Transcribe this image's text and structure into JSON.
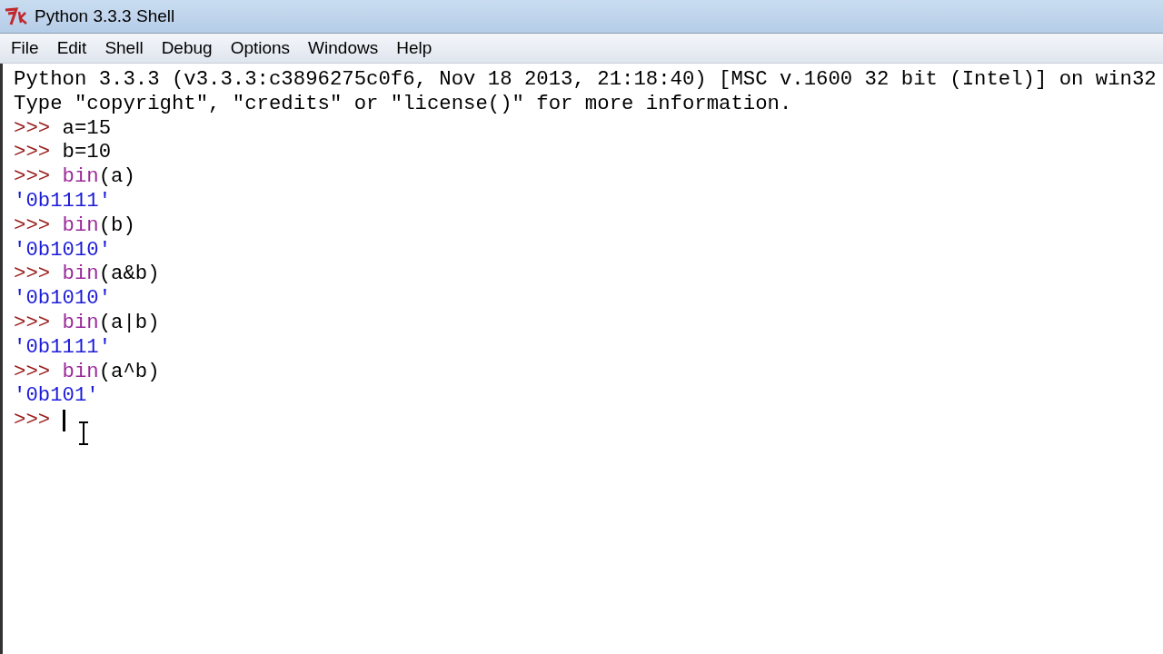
{
  "window": {
    "title": "Python 3.3.3 Shell"
  },
  "menu": [
    "File",
    "Edit",
    "Shell",
    "Debug",
    "Options",
    "Windows",
    "Help"
  ],
  "lines": [
    {
      "kind": "banner",
      "text": "Python 3.3.3 (v3.3.3:c3896275c0f6, Nov 18 2013, 21:18:40) [MSC v.1600 32 bit (Intel)] on win32"
    },
    {
      "kind": "banner",
      "text": "Type \"copyright\", \"credits\" or \"license()\" for more information."
    },
    {
      "kind": "input",
      "prompt": ">>>",
      "parts": [
        {
          "kind": "plain",
          "text": "a=15"
        }
      ]
    },
    {
      "kind": "input",
      "prompt": ">>>",
      "parts": [
        {
          "kind": "plain",
          "text": "b=10"
        }
      ]
    },
    {
      "kind": "input",
      "prompt": ">>>",
      "parts": [
        {
          "kind": "builtin",
          "text": "bin"
        },
        {
          "kind": "plain",
          "text": "(a)"
        }
      ]
    },
    {
      "kind": "output",
      "text": "'0b1111'"
    },
    {
      "kind": "input",
      "prompt": ">>>",
      "parts": [
        {
          "kind": "builtin",
          "text": "bin"
        },
        {
          "kind": "plain",
          "text": "(b)"
        }
      ]
    },
    {
      "kind": "output",
      "text": "'0b1010'"
    },
    {
      "kind": "input",
      "prompt": ">>>",
      "parts": [
        {
          "kind": "builtin",
          "text": "bin"
        },
        {
          "kind": "plain",
          "text": "(a&b)"
        }
      ]
    },
    {
      "kind": "output",
      "text": "'0b1010'"
    },
    {
      "kind": "input",
      "prompt": ">>>",
      "parts": [
        {
          "kind": "builtin",
          "text": "bin"
        },
        {
          "kind": "plain",
          "text": "(a|b)"
        }
      ]
    },
    {
      "kind": "output",
      "text": "'0b1111'"
    },
    {
      "kind": "input",
      "prompt": ">>>",
      "parts": [
        {
          "kind": "builtin",
          "text": "bin"
        },
        {
          "kind": "plain",
          "text": "(a^b)"
        }
      ]
    },
    {
      "kind": "output",
      "text": "'0b101'"
    },
    {
      "kind": "prompt",
      "prompt": ">>>",
      "cursor": true
    }
  ]
}
